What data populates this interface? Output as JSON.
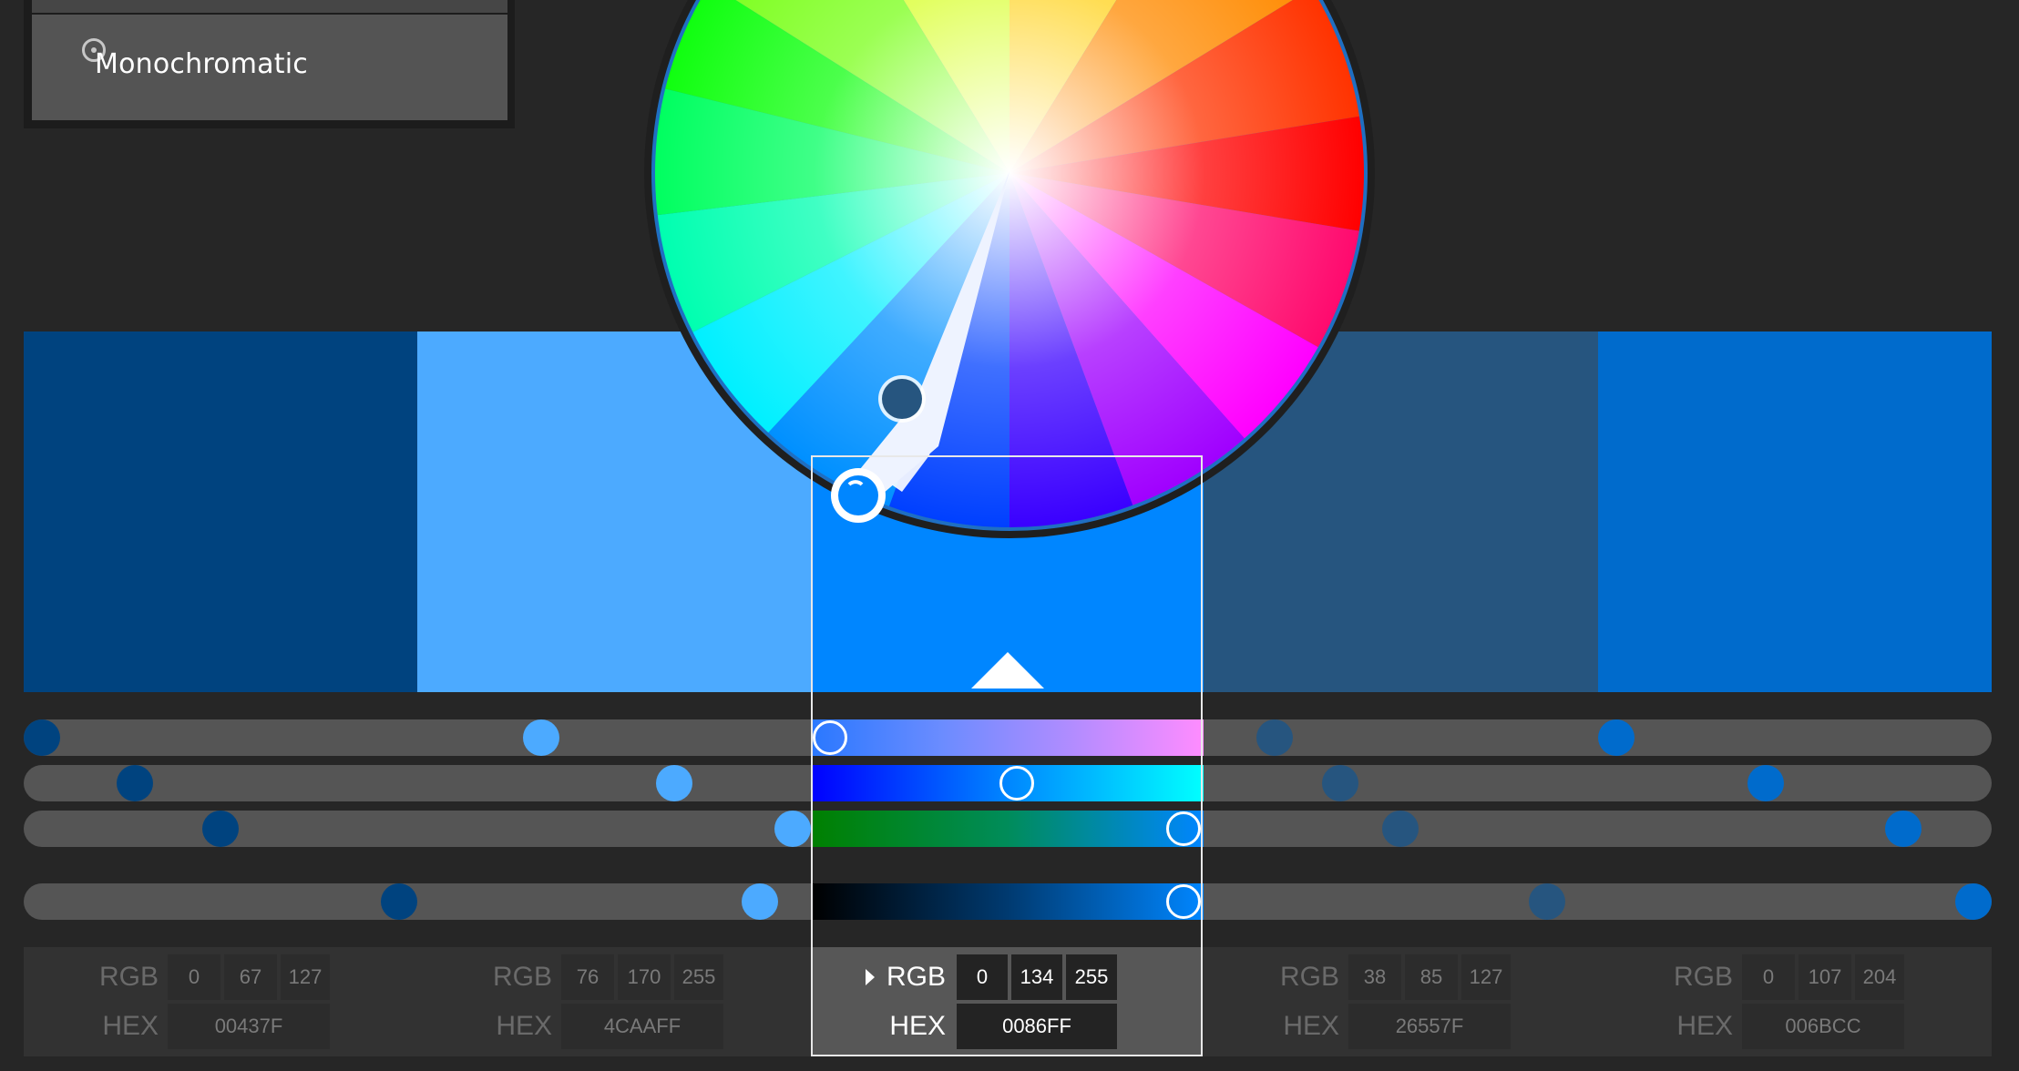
{
  "color_rule": {
    "selected_label": "Monochromatic"
  },
  "swatches": [
    {
      "hex": "#00437F",
      "rgb": [
        "0",
        "67",
        "127"
      ],
      "hex_text": "00437F"
    },
    {
      "hex": "#4CAAFF",
      "rgb": [
        "76",
        "170",
        "255"
      ],
      "hex_text": "4CAAFF"
    },
    {
      "hex": "#0086FF",
      "rgb": [
        "0",
        "134",
        "255"
      ],
      "hex_text": "0086FF"
    },
    {
      "hex": "#26557F",
      "rgb": [
        "38",
        "85",
        "127"
      ],
      "hex_text": "26557F"
    },
    {
      "hex": "#006BCC",
      "rgb": [
        "0",
        "107",
        "204"
      ],
      "hex_text": "006BCC"
    }
  ],
  "active_swatch_index": 2,
  "labels": {
    "rgb": "RGB",
    "hex": "HEX"
  },
  "slider_levels": {
    "hue": [
      0.01,
      0.26,
      0.41,
      0.63,
      0.81
    ],
    "saturation": [
      0.06,
      0.33,
      0.49,
      0.67,
      0.88
    ],
    "brightness": [
      0.1,
      0.39,
      1.0,
      0.7,
      0.95
    ],
    "value": [
      0.19,
      0.37,
      1.0,
      0.77,
      0.99
    ]
  },
  "icons": {
    "rule_radio": "radio-icon",
    "expand_caret": "caret-right-icon",
    "base_color_marker": "up-triangle-icon"
  }
}
